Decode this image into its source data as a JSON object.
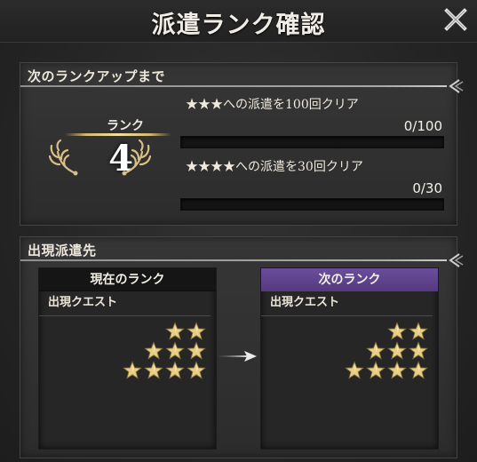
{
  "title": "派遣ランク確認",
  "next_rank_section": {
    "header": "次のランクアップまで",
    "rank_label": "ランク",
    "rank_value": "4",
    "missions": [
      {
        "text": "★★★への派遣を100回クリア",
        "count": "0/100",
        "progress": 0
      },
      {
        "text": "★★★★への派遣を30回クリア",
        "count": "0/30",
        "progress": 0
      }
    ]
  },
  "appearance_section": {
    "header": "出現派遣先",
    "current_rank": {
      "header": "現在のランク",
      "subheader": "出現クエスト",
      "star_rows": [
        2,
        3,
        4
      ]
    },
    "next_rank": {
      "header": "次のランク",
      "subheader": "出現クエスト",
      "star_rows": [
        2,
        3,
        4
      ]
    }
  },
  "colors": {
    "star_gold": "#e8cf86",
    "next_rank_header": "#5e4390",
    "progress_fill": "#d4b26a"
  },
  "icons": {
    "close": "close-icon",
    "laurel": "laurel-icon",
    "star": "star-icon",
    "arrow": "arrow-right-icon",
    "ornament": "line-ornament-icon"
  }
}
